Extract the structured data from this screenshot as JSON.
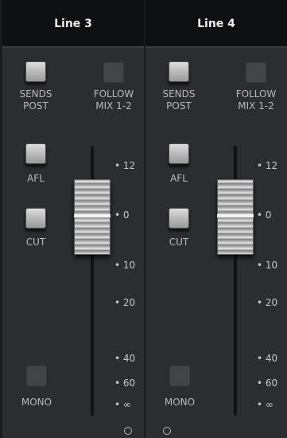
{
  "channels": [
    {
      "name": "Line 3",
      "sends_post_label": [
        "SENDS",
        "POST"
      ],
      "follow_label": [
        "FOLLOW",
        "MIX 1-2"
      ],
      "afl_label": "AFL",
      "cut_label": "CUT",
      "mono_label": "MONO",
      "scale": [
        "• 12",
        "• 0",
        "• 10",
        "• 20",
        "• 40",
        "• 60",
        "• ∞"
      ],
      "fader_level_db": 0
    },
    {
      "name": "Line 4",
      "sends_post_label": [
        "SENDS",
        "POST"
      ],
      "follow_label": [
        "FOLLOW",
        "MIX 1-2"
      ],
      "afl_label": "AFL",
      "cut_label": "CUT",
      "mono_label": "MONO",
      "scale": [
        "• 12",
        "• 0",
        "• 10",
        "• 20",
        "• 40",
        "• 60",
        "• ∞"
      ],
      "fader_level_db": 0
    }
  ],
  "colors": {
    "background": "#1a1b1d",
    "strip": "#2c2d30",
    "header": "#0f1011",
    "label": "#b9b9b9"
  }
}
